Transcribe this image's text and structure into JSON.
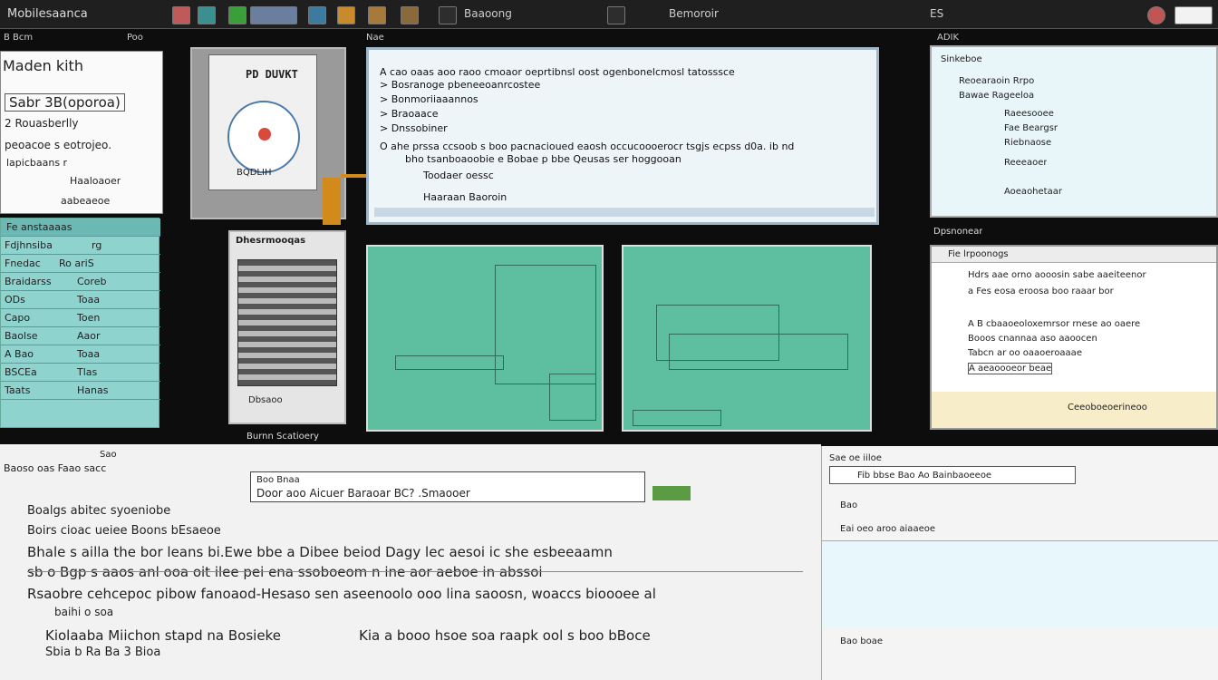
{
  "toolbar": {
    "title": "Mobilesaanca",
    "tab_prefix": "Baaoong",
    "tab_mid": "Bemoroir",
    "tab_right": "ES"
  },
  "left": {
    "header": [
      "B Bcm",
      "Poo"
    ],
    "headline1": "Maden kith",
    "headline2": "Sabr 3B(oporoa)",
    "line3": "2 Rouasberlly",
    "line4": "peoacoe s eotrojeo.",
    "line5": "lapicbaans r",
    "line6": "Haaloaoer",
    "line7": "aabeaeoe",
    "table_title": "Fe anstaaaas",
    "rows": [
      [
        "Fdjhnsiba",
        "rg"
      ],
      [
        "Fnedac",
        "Ro ariS"
      ],
      [
        "Braidarss",
        "Coreb"
      ],
      [
        "ODs",
        "Toaa"
      ],
      [
        "Capo",
        "Toen"
      ],
      [
        "Baolse",
        "Aaor"
      ],
      [
        "A Bao",
        "Toaa"
      ],
      [
        "BSCEa",
        "Tlas"
      ],
      [
        "Taats",
        "Hanas"
      ]
    ]
  },
  "thumb1": {
    "label": "PD DUVKT",
    "caption": "BQDLIH"
  },
  "thumb2": {
    "label": "Dhesrmooqas",
    "caption": "Dbsaoo"
  },
  "thumb2_footer": "Burnn Scatioery",
  "center_label": "Nae",
  "right_label": "ADIK",
  "code": {
    "lines": [
      "A cao oaas aoo raoo cmoaor oeprtibnsl oost ogenbonelcmosl tatosssce",
      "> Bosranoge pbeneeoanrcostee",
      "> Bonmoriiaaannos",
      "> Braoaace",
      "> Dnssobiner",
      "O ahe prssa ccsoob s boo pacnacioued eaosh occucoooerocr tsgjs ecpss d0a. ib nd",
      "bho tsanboaoobie e Bobae p bbe Qeusas ser hoggooan",
      "Toodaer oessc",
      "Haaraan Baoroin"
    ]
  },
  "right_top": {
    "title": "Sinkeboe",
    "items": [
      "Reoearaoin Rrpo",
      "Bawae Rageeloa",
      "Raeesooee",
      "Fae Beargsr",
      "Riebnaose",
      "Reeeaoer",
      "Aoeaohetaar"
    ],
    "footer": "Dpsnonear"
  },
  "right_mid": {
    "title": "Fie lrpoonogs",
    "lines": [
      "Hdrs aae orno aooosin sabe aaeiteenor",
      "a Fes eosa eroosa boo raaar bor",
      "A B cbaaoeoloxemrsor rnese ao oaere",
      "Booos cnannaa aso aaoocen",
      "Tabcn ar oo oaaoeroaaae",
      "A aeaoooeor beae"
    ],
    "footer_text": "Ceeoboeoerineoo"
  },
  "bottom_left": {
    "tiny": "Sao",
    "subtitle": "Baoso oas Faao sacc",
    "search_label": "Boo Bnaa",
    "search_value": "Door aoo Aicuer Baraoar BC? .Smaooer",
    "lines": [
      "Boalgs abitec syoeniobe",
      "Boirs cioac ueiee Boons bEsaeoe",
      "Bhale s ailla the bor leans bi.Ewe bbe a Dibee beiod Dagy lec aesoi ic she esbeeaamn",
      "sb o Bgp s aaos anl ooa oit ilee pei ena ssoboeom n ine aor aeboe in abssoi",
      "Rsaobre cehcepoc pibow fanoaod-Hesaso sen aseenoolo ooo lina saoosn, woaccs bioooee al",
      "baihi o soa",
      "Kiolaaba Miichon stapd na Bosieke",
      "Kia a booo hsoe soa raapk ool s boo bBoce",
      "Sbia b Ra Ba 3 Bioa"
    ]
  },
  "bottom_right": {
    "header": "Sae oe iiloe",
    "item1": "Fib bbse Bao Ao Bainbaoeeoe",
    "item2": "Bao",
    "item3": "Eai oeo aroo aiaaeoe",
    "footer": "Bao boae"
  }
}
